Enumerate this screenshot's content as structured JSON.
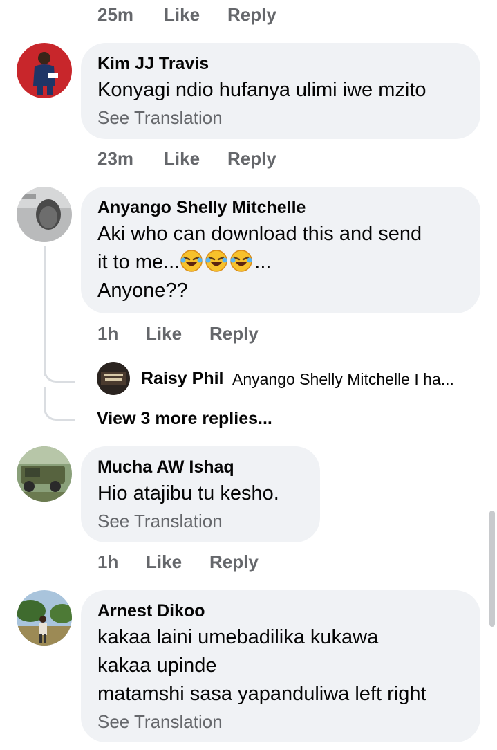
{
  "top_actions": {
    "time": "25m",
    "like": "Like",
    "reply": "Reply"
  },
  "comments": [
    {
      "author": "Kim JJ Travis",
      "text": [
        "Konyagi ndio hufanya ulimi iwe mzito"
      ],
      "translation": "See Translation",
      "time": "23m",
      "like": "Like",
      "reply": "Reply"
    },
    {
      "author": "Anyango Shelly Mitchelle",
      "text_line1": "Aki who can download this and send",
      "text_line2_prefix": "it to me...",
      "text_line2_suffix": "...",
      "text_line3": "Anyone??",
      "emojis": [
        "rolling-on-floor-laughing",
        "rolling-on-floor-laughing",
        "rolling-on-floor-laughing"
      ],
      "time": "1h",
      "like": "Like",
      "reply": "Reply",
      "reply_preview": {
        "author": "Raisy Phil",
        "text": "Anyango Shelly Mitchelle I ha..."
      },
      "view_more": "View 3 more replies..."
    },
    {
      "author": "Mucha AW Ishaq",
      "text": [
        "Hio atajibu tu kesho."
      ],
      "translation": "See Translation",
      "time": "1h",
      "like": "Like",
      "reply": "Reply"
    },
    {
      "author": "Arnest Dikoo",
      "text": [
        "kakaa laini umebadilika kukawa",
        "kakaa upinde",
        "matamshi sasa yapanduliwa left right"
      ],
      "translation": "See Translation"
    }
  ],
  "colors": {
    "bubble": "#f0f2f5",
    "secondary_text": "#65676b",
    "primary_text": "#050505",
    "thread_line": "#dadde1"
  }
}
